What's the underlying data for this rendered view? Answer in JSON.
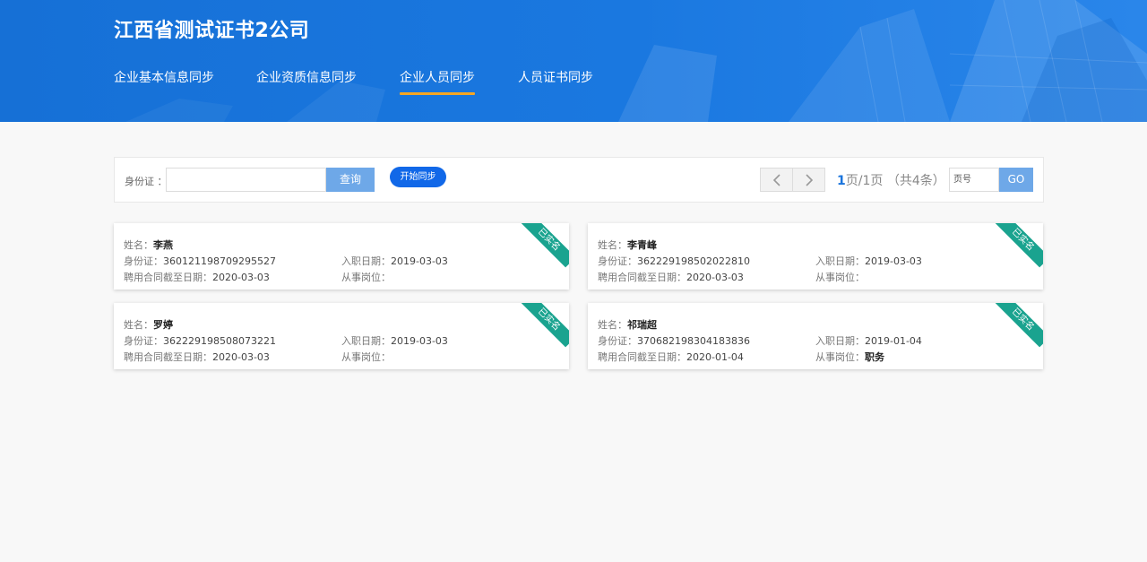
{
  "header": {
    "company": "江西省测试证书2公司",
    "tabs": [
      {
        "label": "企业基本信息同步",
        "active": false
      },
      {
        "label": "企业资质信息同步",
        "active": false
      },
      {
        "label": "企业人员同步",
        "active": true
      },
      {
        "label": "人员证书同步",
        "active": false
      }
    ],
    "colors": {
      "header_bg": "#1a74dc",
      "active_underline": "#f5a623"
    }
  },
  "toolbar": {
    "id_label": "身份证 ：",
    "id_value": "",
    "query_label": "查询",
    "sync_label": "开始同步",
    "pagination": {
      "prev_icon": "chevron-left-icon",
      "next_icon": "chevron-right-icon",
      "current": "1",
      "rest": "页/1页 （共4条）",
      "page_input_placeholder": "页号",
      "go_label": "GO"
    }
  },
  "labels": {
    "name": "姓名：",
    "id": "身份证：",
    "contract": "聘用合同截至日期：",
    "entry": "入职日期：",
    "post": "从事岗位："
  },
  "cards": [
    {
      "name": "李燕",
      "id": "360121198709295527",
      "contract_end": "2020-03-03",
      "entry_date": "2019-03-03",
      "post": "",
      "badge": "已实名"
    },
    {
      "name": "李青峰",
      "id": "362229198502022810",
      "contract_end": "2020-03-03",
      "entry_date": "2019-03-03",
      "post": "",
      "badge": "已实名"
    },
    {
      "name": "罗婷",
      "id": "362229198508073221",
      "contract_end": "2020-03-03",
      "entry_date": "2019-03-03",
      "post": "",
      "badge": "已实名"
    },
    {
      "name": "祁瑞超",
      "id": "370682198304183836",
      "contract_end": "2020-01-04",
      "entry_date": "2019-01-04",
      "post": "职务",
      "badge": "已实名"
    }
  ],
  "colors": {
    "badge": "#1aa38f",
    "button_light": "#6ea8e8",
    "button_primary": "#1168e8"
  }
}
